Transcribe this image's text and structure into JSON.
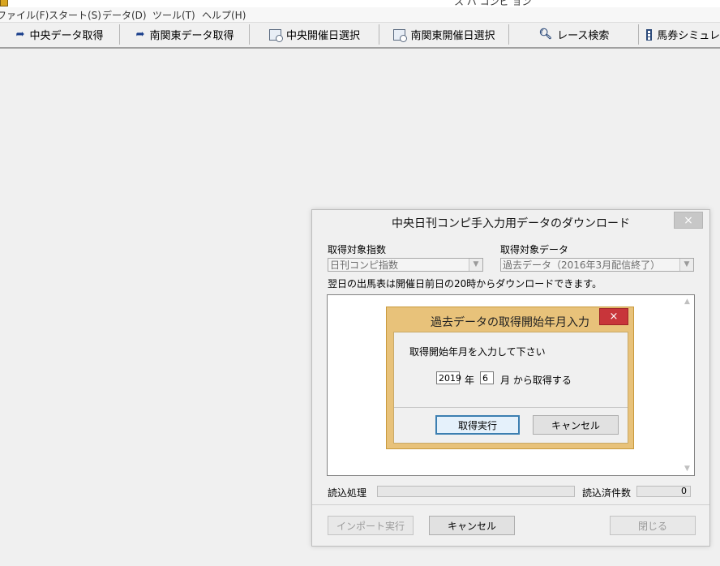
{
  "window": {
    "title_partial": "ス バ コンビ  ョン"
  },
  "menu": [
    {
      "label": "ファイル(F)"
    },
    {
      "label": "スタート(S)"
    },
    {
      "label": "データ(D)"
    },
    {
      "label": "ツール(T)"
    },
    {
      "label": "ヘルプ(H)"
    }
  ],
  "toolbar": [
    {
      "label": "中央データ取得",
      "icon": "arrow-right-icon"
    },
    {
      "label": "南関東データ取得",
      "icon": "arrow-right-icon"
    },
    {
      "label": "中央開催日選択",
      "icon": "calendar-clock-icon"
    },
    {
      "label": "南関東開催日選択",
      "icon": "calendar-clock-icon"
    },
    {
      "label": "レース検索",
      "icon": "search-icon"
    },
    {
      "label": "馬券シミュレ",
      "icon": "table-icon"
    }
  ],
  "download_dialog": {
    "title": "中央日刊コンピ手入力用データのダウンロード",
    "close_label": "×",
    "target_index_label": "取得対象指数",
    "target_index_value": "日刊コンピ指数",
    "target_data_label": "取得対象データ",
    "target_data_value": "過去データ（2016年3月配信終了）",
    "notice": "翌日の出馬表は開催日前日の20時からダウンロードできます。",
    "read_process_label": "読込処理",
    "read_count_label": "読込済件数",
    "read_count_value": "0",
    "progress": 0,
    "buttons": {
      "import": "インポート実行",
      "cancel": "キャンセル",
      "close": "閉じる"
    }
  },
  "start_month_dialog": {
    "title": "過去データの取得開始年月入力",
    "close_label": "×",
    "prompt": "取得開始年月を入力して下さい",
    "year_value": "2019",
    "year_unit": "年",
    "month_value": "6",
    "month_unit": "月 から取得する",
    "buttons": {
      "execute": "取得実行",
      "cancel": "キャンセル"
    }
  },
  "colors": {
    "modal_frame": "#e8c27a",
    "modal_close": "#c8353a",
    "background": "#f0f0f0"
  }
}
